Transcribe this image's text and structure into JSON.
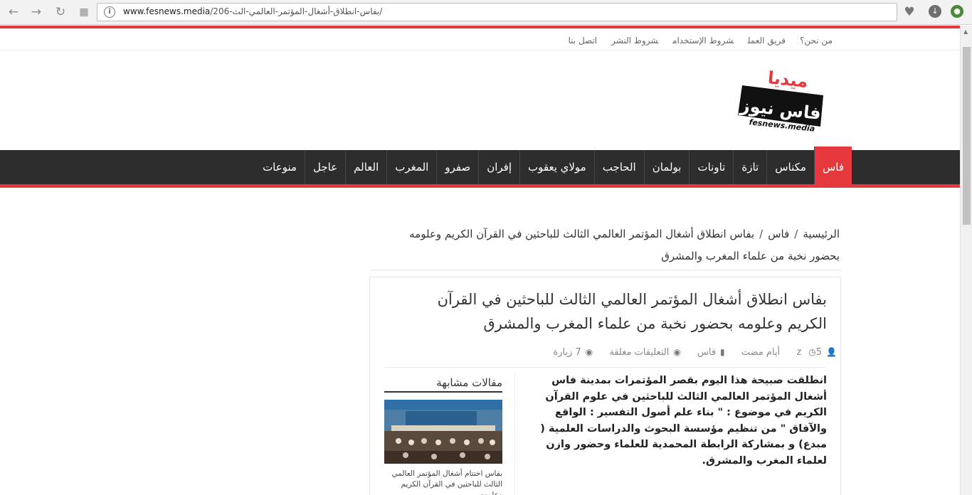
{
  "browser": {
    "url_domain": "www.fesnews.media",
    "url_path": "/206-بفاس-انطلاق-أشغال-المؤتمر-العالمي-الث/"
  },
  "top_links": [
    "من نحن؟",
    "فريق العمل",
    "شروط الإستخدام",
    "شروط النشر",
    "اتصل بنا"
  ],
  "logo": {
    "main": "فاس نيوز",
    "media": "ميديا",
    "sub": "fesnews.media"
  },
  "nav": [
    "فاس",
    "مكناس",
    "تازة",
    "تاونات",
    "بولمان",
    "الحاجب",
    "مولاي يعقوب",
    "إفران",
    "صفرو",
    "المغرب",
    "العالم",
    "عاجل",
    "منوعات"
  ],
  "breadcrumb": {
    "home": "الرئيسية",
    "category": "فاس",
    "current": "بفاس انطلاق أشغال المؤتمر العالمي الثالث للباحثين في القرآن الكريم وعلومه بحضور نخبة من علماء المغرب والمشرق",
    "separator": "/"
  },
  "article": {
    "title": "بفاس انطلاق أشغال المؤتمر العالمي الثالث للباحثين في القرآن الكريم وعلومه بحضور نخبة من علماء المغرب والمشرق",
    "author": "z",
    "date": "5 أيام مضت",
    "category": "فاس",
    "comments": "التعليقات مغلقة",
    "views": "7 زيارة",
    "body": "انطلقت صبيحة هذا اليوم بقصر المؤتمرات بمدينة فاس أشغال المؤتمر العالمي الثالث للباحثين في علوم القرآن الكريم  في موضوع : \" بناء علم أصول التفسير : الواقع والآفاق \" من تنظيم مؤسسة البحوث والدراسات العلمية ( مبدع) و بمشاركة الرابطة المحمدية للعلماء وحضور وازن لعلماء المغرب والمشرق."
  },
  "related": {
    "heading": "مقالات مشابهة",
    "caption": "بفاس اختتام أشغال المؤتمر العالمي الثالث للباحثين في القرآن الكريم وعلومه"
  },
  "icons": {
    "author": "user-icon",
    "date": "clock-icon",
    "category": "folder-icon",
    "comments": "comments-icon",
    "views": "eye-icon"
  },
  "colors": {
    "accent": "#e5393d",
    "nav_bg": "#2d2d2d"
  }
}
